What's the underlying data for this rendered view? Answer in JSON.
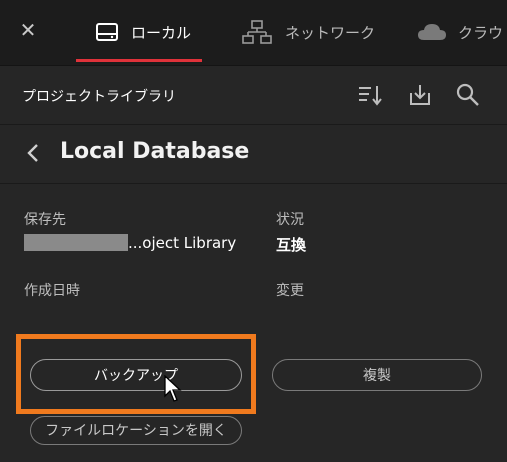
{
  "topbar": {
    "tabs": [
      {
        "label": "ローカル",
        "icon": "local-drive-icon"
      },
      {
        "label": "ネットワーク",
        "icon": "network-icon"
      },
      {
        "label": "クラウド",
        "icon": "cloud-icon"
      }
    ],
    "accent": "#e0323a"
  },
  "library": {
    "title": "プロジェクトライブラリ",
    "tools": [
      "sort-icon",
      "import-icon",
      "search-icon"
    ]
  },
  "database": {
    "title": "Local Database",
    "fields": {
      "location_label": "保存先",
      "location_value": "...oject Library",
      "status_label": "状況",
      "status_value": "互換",
      "created_label": "作成日時",
      "modified_label": "変更"
    }
  },
  "actions": {
    "backup": "バックアップ",
    "duplicate": "複製",
    "open_location": "ファイルロケーションを開く"
  },
  "highlight_color": "#f07a1e"
}
